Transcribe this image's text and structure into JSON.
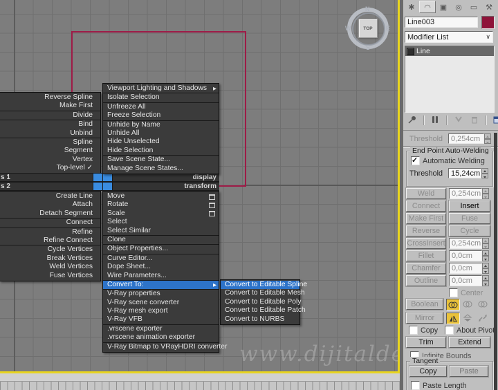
{
  "colors": {
    "highlight_blue": "#2d73c9",
    "quad_square_blue": "#3a8ce0",
    "object_color_maroon": "#8e1339",
    "spline_red": "#9e1b47",
    "active_viewport_yellow": "#e8d41f",
    "icon_active_yellow": "#e9c23b"
  },
  "viewport": {
    "watermark": "www.dijitalde",
    "viewcube": {
      "top_label": "TOP",
      "north": "N",
      "south": "S",
      "east": "E",
      "west": "W"
    }
  },
  "quad_titles": {
    "left_row1": "s 1",
    "left_row2": "s 2",
    "right_row1": "display",
    "right_row2": "transform"
  },
  "menus": {
    "tools1": [
      {
        "label": "Reverse Spline"
      },
      {
        "label": "Make First"
      },
      {
        "label": "Divide",
        "sep": true
      },
      {
        "label": "Bind",
        "sep": true
      },
      {
        "label": "Unbind"
      },
      {
        "label": "Spline",
        "sep": true
      },
      {
        "label": "Segment"
      },
      {
        "label": "Vertex"
      },
      {
        "label": "Top-level",
        "check": true
      }
    ],
    "tools2": [
      {
        "label": "Create Line"
      },
      {
        "label": "Attach"
      },
      {
        "label": "Detach Segment"
      },
      {
        "label": "Connect",
        "sep": true
      },
      {
        "label": "Refine",
        "sep": true
      },
      {
        "label": "Refine Connect"
      },
      {
        "label": "Cycle Vertices",
        "sep": true
      },
      {
        "label": "Break Vertices"
      },
      {
        "label": "Weld Vertices"
      },
      {
        "label": "Fuse Vertices"
      }
    ],
    "display": [
      {
        "label": "Viewport Lighting and Shadows",
        "arrow": true
      },
      {
        "label": "Isolate Selection",
        "sep": true
      },
      {
        "label": "Unfreeze All",
        "sep": true
      },
      {
        "label": "Freeze Selection"
      },
      {
        "label": "Unhide by Name",
        "sep": true
      },
      {
        "label": "Unhide All"
      },
      {
        "label": "Hide Unselected"
      },
      {
        "label": "Hide Selection"
      },
      {
        "label": "Save Scene State...",
        "sep": true
      },
      {
        "label": "Manage Scene States..."
      }
    ],
    "transform": [
      {
        "label": "Move",
        "box": true
      },
      {
        "label": "Rotate",
        "box": true
      },
      {
        "label": "Scale",
        "box": true
      },
      {
        "label": "Select"
      },
      {
        "label": "Select Similar"
      },
      {
        "label": "Clone",
        "sep": true
      },
      {
        "label": "Object Properties...",
        "sep": true
      },
      {
        "label": "Curve Editor...",
        "sep": true
      },
      {
        "label": "Dope Sheet..."
      },
      {
        "label": "Wire Parameters..."
      },
      {
        "label": "Convert To:",
        "sep": true,
        "arrow": true,
        "hl": true
      },
      {
        "label": "V-Ray properties",
        "sep": true
      },
      {
        "label": "V-Ray scene converter"
      },
      {
        "label": "V-Ray mesh export"
      },
      {
        "label": "V-Ray VFB"
      },
      {
        "label": ".vrscene exporter",
        "sep": true
      },
      {
        "label": ".vrscene animation exporter"
      },
      {
        "label": "V-Ray Bitmap to VRayHDRI converter",
        "sep": true
      }
    ],
    "convert_submenu": [
      {
        "label": "Convert to Editable Spline",
        "hl": true
      },
      {
        "label": "Convert to Editable Mesh"
      },
      {
        "label": "Convert to Editable Poly"
      },
      {
        "label": "Convert to Editable Patch"
      },
      {
        "label": "Convert to NURBS"
      }
    ]
  },
  "panel": {
    "tabs": [
      {
        "label": "create",
        "glyph": "✱"
      },
      {
        "label": "modify",
        "glyph": "◠",
        "selected": true
      },
      {
        "label": "hierarchy",
        "glyph": "▣"
      },
      {
        "label": "motion",
        "glyph": "◎"
      },
      {
        "label": "display",
        "glyph": "▭"
      },
      {
        "label": "utilities",
        "glyph": "⚒"
      }
    ],
    "object_name": "Line003",
    "modifier_list_label": "Modifier List",
    "dropdown_chevron": "∨",
    "stack": [
      {
        "label": "Line"
      }
    ],
    "prev_row": {
      "label": "Threshold",
      "value": "0,254cm"
    },
    "autoweld": {
      "title": "End Point Auto-Welding",
      "checkbox_label": "Automatic Welding",
      "checked": true,
      "threshold_label": "Threshold",
      "threshold_value": "15,24cm"
    },
    "ops": {
      "weld": "Weld",
      "weld_value": "0,254cm",
      "connect": "Connect",
      "insert": "Insert",
      "make_first": "Make First",
      "fuse": "Fuse",
      "reverse": "Reverse",
      "cycle": "Cycle",
      "crossinsert": "CrossInsert",
      "crossinsert_value": "0,254cm",
      "fillet": "Fillet",
      "fillet_value": "0,0cm",
      "chamfer": "Chamfer",
      "chamfer_value": "0,0cm",
      "outline": "Outline",
      "outline_value": "0,0cm",
      "center_label": "Center",
      "center_checked": false,
      "boolean": "Boolean",
      "mirror": "Mirror",
      "copy_label": "Copy",
      "copy_checked": false,
      "about_pivot_label": "About Pivot",
      "about_pivot_checked": false,
      "trim": "Trim",
      "extend": "Extend",
      "infinite_bounds_label": "Infinite Bounds",
      "infinite_bounds_checked": false
    },
    "tangent": {
      "title": "Tangent",
      "copy": "Copy",
      "paste": "Paste",
      "paste_length_label": "Paste Length",
      "paste_length_checked": false
    }
  }
}
